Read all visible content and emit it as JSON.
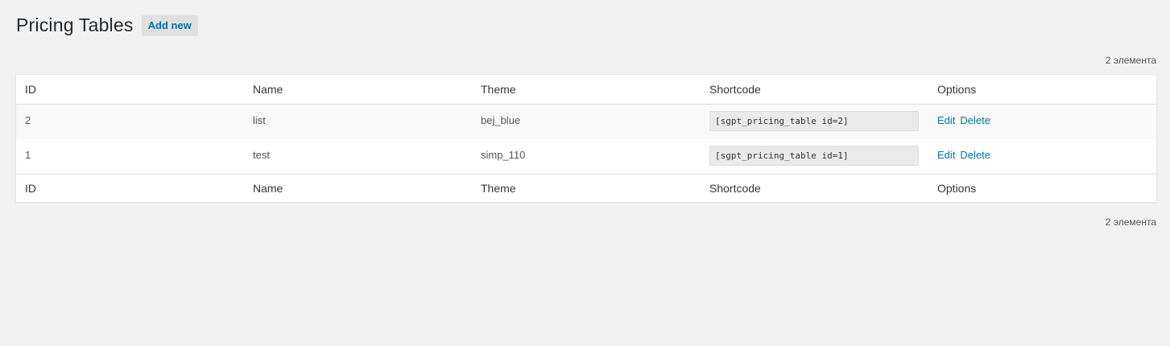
{
  "header": {
    "title": "Pricing Tables",
    "add_new_label": "Add new"
  },
  "count_label": "2 элемента",
  "table": {
    "columns": {
      "id": "ID",
      "name": "Name",
      "theme": "Theme",
      "shortcode": "Shortcode",
      "options": "Options"
    },
    "rows": [
      {
        "id": "2",
        "name": "list",
        "theme": "bej_blue",
        "shortcode": "[sgpt_pricing_table id=2]",
        "edit_label": "Edit",
        "delete_label": "Delete"
      },
      {
        "id": "1",
        "name": "test",
        "theme": "simp_110",
        "shortcode": "[sgpt_pricing_table id=1]",
        "edit_label": "Edit",
        "delete_label": "Delete"
      }
    ]
  },
  "colors": {
    "link": "#0073aa",
    "background": "#f1f1f1",
    "button_bg": "#e0e0e0"
  }
}
